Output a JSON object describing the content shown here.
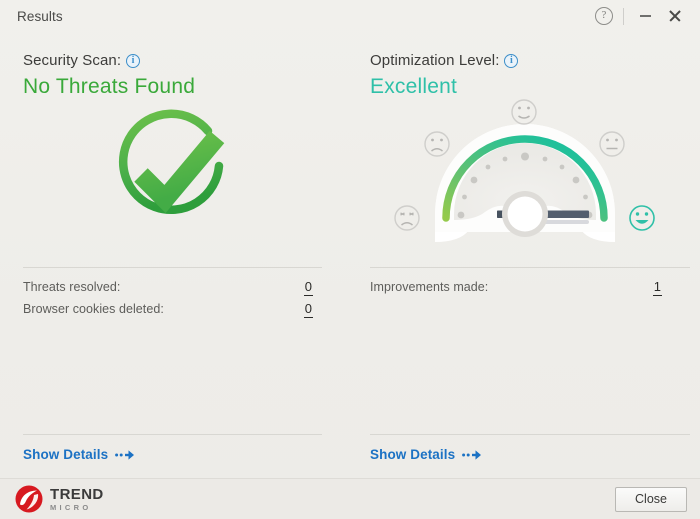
{
  "window": {
    "title": "Results",
    "help_icon": "help-circle-icon",
    "minimize_icon": "minimize-icon",
    "close_icon": "close-icon"
  },
  "security": {
    "heading": "Security Scan:",
    "info_icon": "info-icon",
    "status": "No Threats Found",
    "status_color": "#3aa93a",
    "graphic": "green-check-circle-icon",
    "stats": [
      {
        "label": "Threats resolved:",
        "value": "0"
      },
      {
        "label": "Browser cookies deleted:",
        "value": "0"
      }
    ],
    "show_details": "Show Details",
    "arrow_icon": "dotted-arrow-right-icon"
  },
  "optimization": {
    "heading": "Optimization Level:",
    "info_icon": "info-icon",
    "status": "Excellent",
    "status_color": "#2fc0a8",
    "graphic": "performance-gauge-icon",
    "gauge": {
      "needle_angle_deg": 0,
      "arc_start_color": "#8cc63f",
      "arc_end_color": "#12bfa2",
      "faces": [
        {
          "name": "face-angry-icon",
          "active": false
        },
        {
          "name": "face-sad-icon",
          "active": false
        },
        {
          "name": "face-neutral-icon",
          "active": false
        },
        {
          "name": "face-content-icon",
          "active": false
        },
        {
          "name": "face-happy-icon",
          "active": true
        }
      ]
    },
    "stats": [
      {
        "label": "Improvements made:",
        "value": "1"
      }
    ],
    "show_details": "Show Details",
    "arrow_icon": "dotted-arrow-right-icon"
  },
  "footer": {
    "brand_primary": "TREND",
    "brand_secondary": "MICRO",
    "brand_mark": "trend-micro-logo-icon",
    "brand_color": "#d71920",
    "close_button": "Close"
  }
}
